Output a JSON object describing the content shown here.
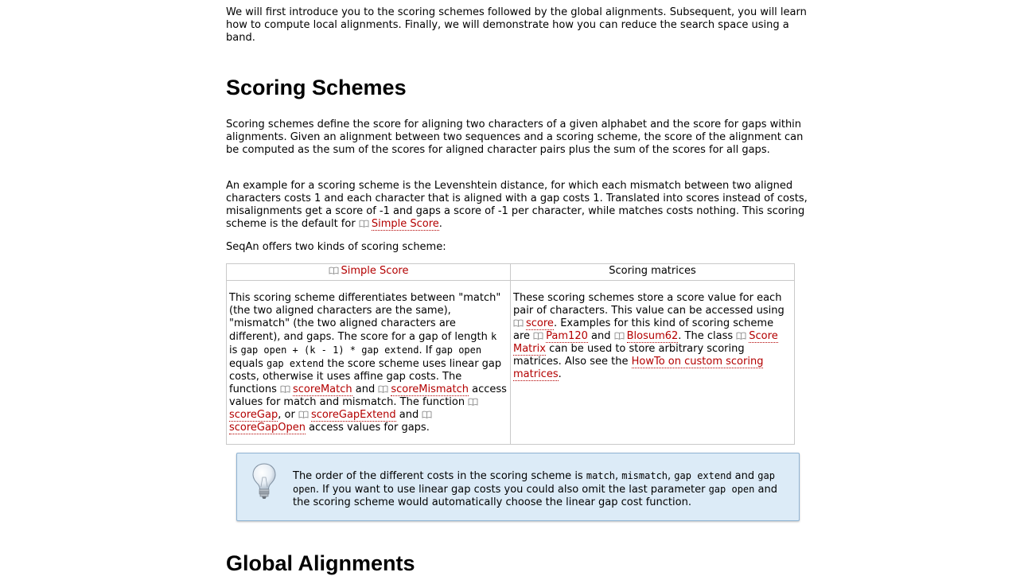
{
  "intro": "We will first introduce you to the scoring schemes followed by the global alignments. Subsequent, you will learn how to compute local alignments. Finally, we will demonstrate how you can reduce the search space using a band.",
  "sections": {
    "scoring_title": "Scoring Schemes",
    "global_title": "Global Alignments"
  },
  "para_scoring": "Scoring schemes define the score for aligning two characters of a given alphabet and the score for gaps within alignments. Given an alignment between two sequences and a scoring scheme, the score of the alignment can be computed as the sum of the scores for aligned character pairs plus the sum of the scores for all gaps.",
  "para_example": {
    "text": "An example for a scoring scheme is the Levenshtein distance, for which each mismatch between two aligned characters costs 1 and each character that is aligned with a gap costs 1. Translated into scores instead of costs, misalignments get a score of -1 and gaps a score of -1 per character, while matches costs nothing. This scoring scheme is the default for ",
    "link": "Simple Score",
    "end": "."
  },
  "para_kinds": "SeqAn offers two kinds of scoring scheme:",
  "table": {
    "col1_header": "Simple Score",
    "col2_header": "Scoring matrices",
    "col1": {
      "t1": "This scoring scheme differentiates between \"match\" (the two aligned characters are the same), \"mismatch\" (the two aligned characters are different), and gaps. The score for a gap of length ",
      "c1": "k",
      "t2": " is ",
      "c2": "gap open + (k - 1) * gap extend",
      "t3": ". If ",
      "c3": "gap open",
      "t4": " equals ",
      "c4": "gap extend",
      "t5": " the score scheme uses linear gap costs, otherwise it uses affine gap costs. The functions ",
      "l1": "scoreMatch",
      "t6": " and ",
      "l2": "scoreMismatch",
      "t7": " access values for match and mismatch. The function ",
      "l3": "scoreGap",
      "t8": ", or ",
      "l4": "scoreGapExtend",
      "t9": " and ",
      "l5": "scoreGapOpen",
      "t10": " access values for gaps."
    },
    "col2": {
      "t1": "These scoring schemes store a score value for each pair of characters. This value can be accessed using ",
      "l1": "score",
      "t2": ". Examples for this kind of scoring scheme are ",
      "l2": "Pam120",
      "t3": " and ",
      "l3": "Blosum62",
      "t4": ". The class ",
      "l4": "Score Matrix",
      "t5": " can be used to store arbitrary scoring matrices. Also see the ",
      "l5": "HowTo on custom scoring matrices",
      "t6": "."
    }
  },
  "note": {
    "icon": "lightbulb-icon",
    "t1": "The order of the different costs in the scoring scheme is ",
    "c1": "match",
    "t2": ", ",
    "c2": "mismatch",
    "t3": ", ",
    "c3": "gap extend",
    "t4": " and ",
    "c4": "gap open",
    "t5": ". If you want to use linear gap costs you could also omit the last parameter ",
    "c5": "gap open",
    "t6": " and the scoring scheme would automatically choose the linear gap cost function."
  },
  "colors": {
    "link": "#b30000",
    "note_bg": "#dcebf7",
    "note_border": "#8fb3d3",
    "table_border": "#c9c9c9"
  }
}
